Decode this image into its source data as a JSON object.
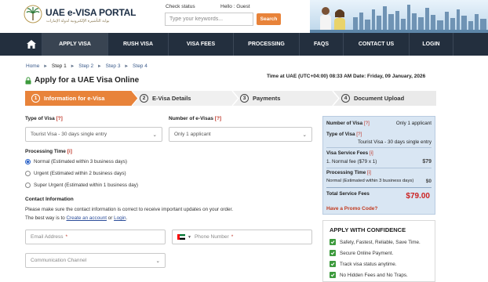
{
  "header": {
    "brand": "UAE e-VISA PORTAL",
    "brand_sub": "بوابة التأشيرة الإلكترونية لدولة الإمارات",
    "check_status": "Check status",
    "hello": "Hello : Guest",
    "search_placeholder": "Type your keywords...",
    "search_button": "Search"
  },
  "nav": {
    "items": [
      {
        "label": "APPLY VISA"
      },
      {
        "label": "RUSH VISA"
      },
      {
        "label": "VISA FEES"
      },
      {
        "label": "PROCESSING"
      },
      {
        "label": "FAQS"
      },
      {
        "label": "CONTACT US"
      },
      {
        "label": "LOGIN"
      }
    ]
  },
  "breadcrumb": {
    "items": [
      "Home",
      "Step 1",
      "Step 2",
      "Step 3",
      "Step 4"
    ]
  },
  "page": {
    "title": "Apply for a UAE Visa Online",
    "time": "Time at UAE (UTC+04:00) 08:33 AM Date: Friday, 09 January, 2026"
  },
  "steps": [
    {
      "num": "1",
      "label": "Information for e-Visa"
    },
    {
      "num": "2",
      "label": "E-Visa Details"
    },
    {
      "num": "3",
      "label": "Payments"
    },
    {
      "num": "4",
      "label": "Document Upload"
    }
  ],
  "form": {
    "type_label": "Type of Visa",
    "type_help": "[?]",
    "type_value": "Tourist Visa - 30 days single entry",
    "num_label": "Number of e-Visas",
    "num_help": "[?]",
    "num_value": "Only 1 applicant",
    "processing_label": "Processing Time",
    "processing_help": "[i]",
    "processing_options": [
      "Normal (Estimated within 3 business days)",
      "Urgent (Estimated within 2 business days)",
      "Super Urgent (Estimated within 1 business day)"
    ],
    "contact_label": "Contact Information",
    "contact_note": "Please make sure the contact information is correct to receive important updates on your order.",
    "contact_way_prefix": "The best way is to",
    "create_account": "Create an account",
    "or": "or",
    "login": "Login",
    "email_placeholder": "Email Address",
    "phone_placeholder": "Phone Number",
    "channel_placeholder": "Communication Channel",
    "required_mark": "*"
  },
  "summary": {
    "num_label": "Number of Visa",
    "num_help": "[?]",
    "num_value": "Only 1 applicant",
    "type_label": "Type of Visa",
    "type_help": "[?]",
    "type_value": "Tourist Visa - 30 days single entry",
    "fees_label": "Visa Service Fees",
    "fees_help": "[i]",
    "fee_line": "1. Normal fee ($79 x 1)",
    "fee_amount": "$79",
    "proc_label": "Processing Time",
    "proc_help": "[i]",
    "proc_value": "Normal (Estimated within 3 business days)",
    "proc_amount": "$0",
    "total_label": "Total Service Fees",
    "total_amount": "$79.00",
    "promo": "Have a Promo Code?"
  },
  "confidence": {
    "title": "APPLY WITH CONFIDENCE",
    "items": [
      "Safety, Fastest, Reliable, Save Time.",
      "Secure Online Payment.",
      "Track visa status anytime.",
      "No Hidden Fees and No Traps."
    ]
  },
  "colors": {
    "accent": "#e8833a",
    "nav": "#232f3e",
    "summary_bg": "#d9e6f3",
    "price": "#cc2222"
  }
}
